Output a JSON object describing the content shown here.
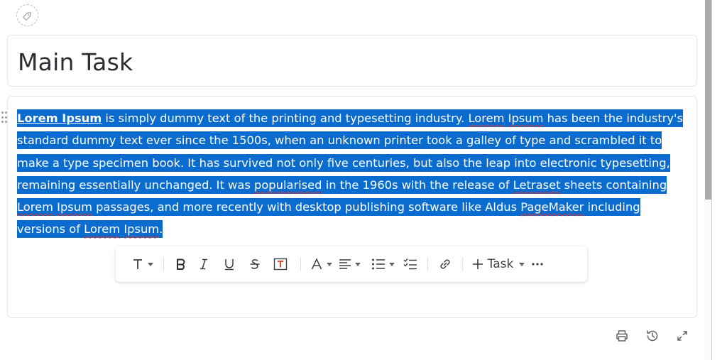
{
  "task": {
    "title": "Main Task"
  },
  "editor": {
    "segments": [
      {
        "text": "Lorem Ipsum",
        "bold": true,
        "underline": true
      },
      {
        "text": " is simply dummy text of the printing and  typesetting industry. "
      },
      {
        "text": "Lorem",
        "spell": true
      },
      {
        "text": " "
      },
      {
        "text": "Ipsum",
        "spell": true
      },
      {
        "text": " has been the industry's standard dummy  text ever since the 1500s, when an unknown printer took a galley of  type and scrambled it to make a type specimen book. It has survived not  only five centuries, but also the leap into electronic typesetting,  remaining essentially unchanged. It was "
      },
      {
        "text": "popularised",
        "spell": true
      },
      {
        "text": " in the 1960s with  the release of "
      },
      {
        "text": "Letraset",
        "spell": true
      },
      {
        "text": " sheets containing  "
      },
      {
        "text": "Lorem",
        "spell": true
      },
      {
        "text": " "
      },
      {
        "text": "Ipsum",
        "spell": true
      },
      {
        "text": " passages, and more  recently with desktop publishing software like Aldus "
      },
      {
        "text": "PageMaker",
        "spell": true
      },
      {
        "text": "  including versions of "
      },
      {
        "text": "Lorem",
        "spell": true
      },
      {
        "text": " "
      },
      {
        "text": "Ipsum",
        "spell": true
      },
      {
        "text": "."
      }
    ]
  },
  "toolbar": {
    "task_label": "Task"
  },
  "icons": {
    "tag": "tag-icon",
    "print": "print-icon",
    "history": "history-icon",
    "expand": "expand-icon"
  },
  "colors": {
    "selection": "#0b6ccf",
    "spellcheck": "#e0322d",
    "text_color_indicator": "#d93025"
  }
}
